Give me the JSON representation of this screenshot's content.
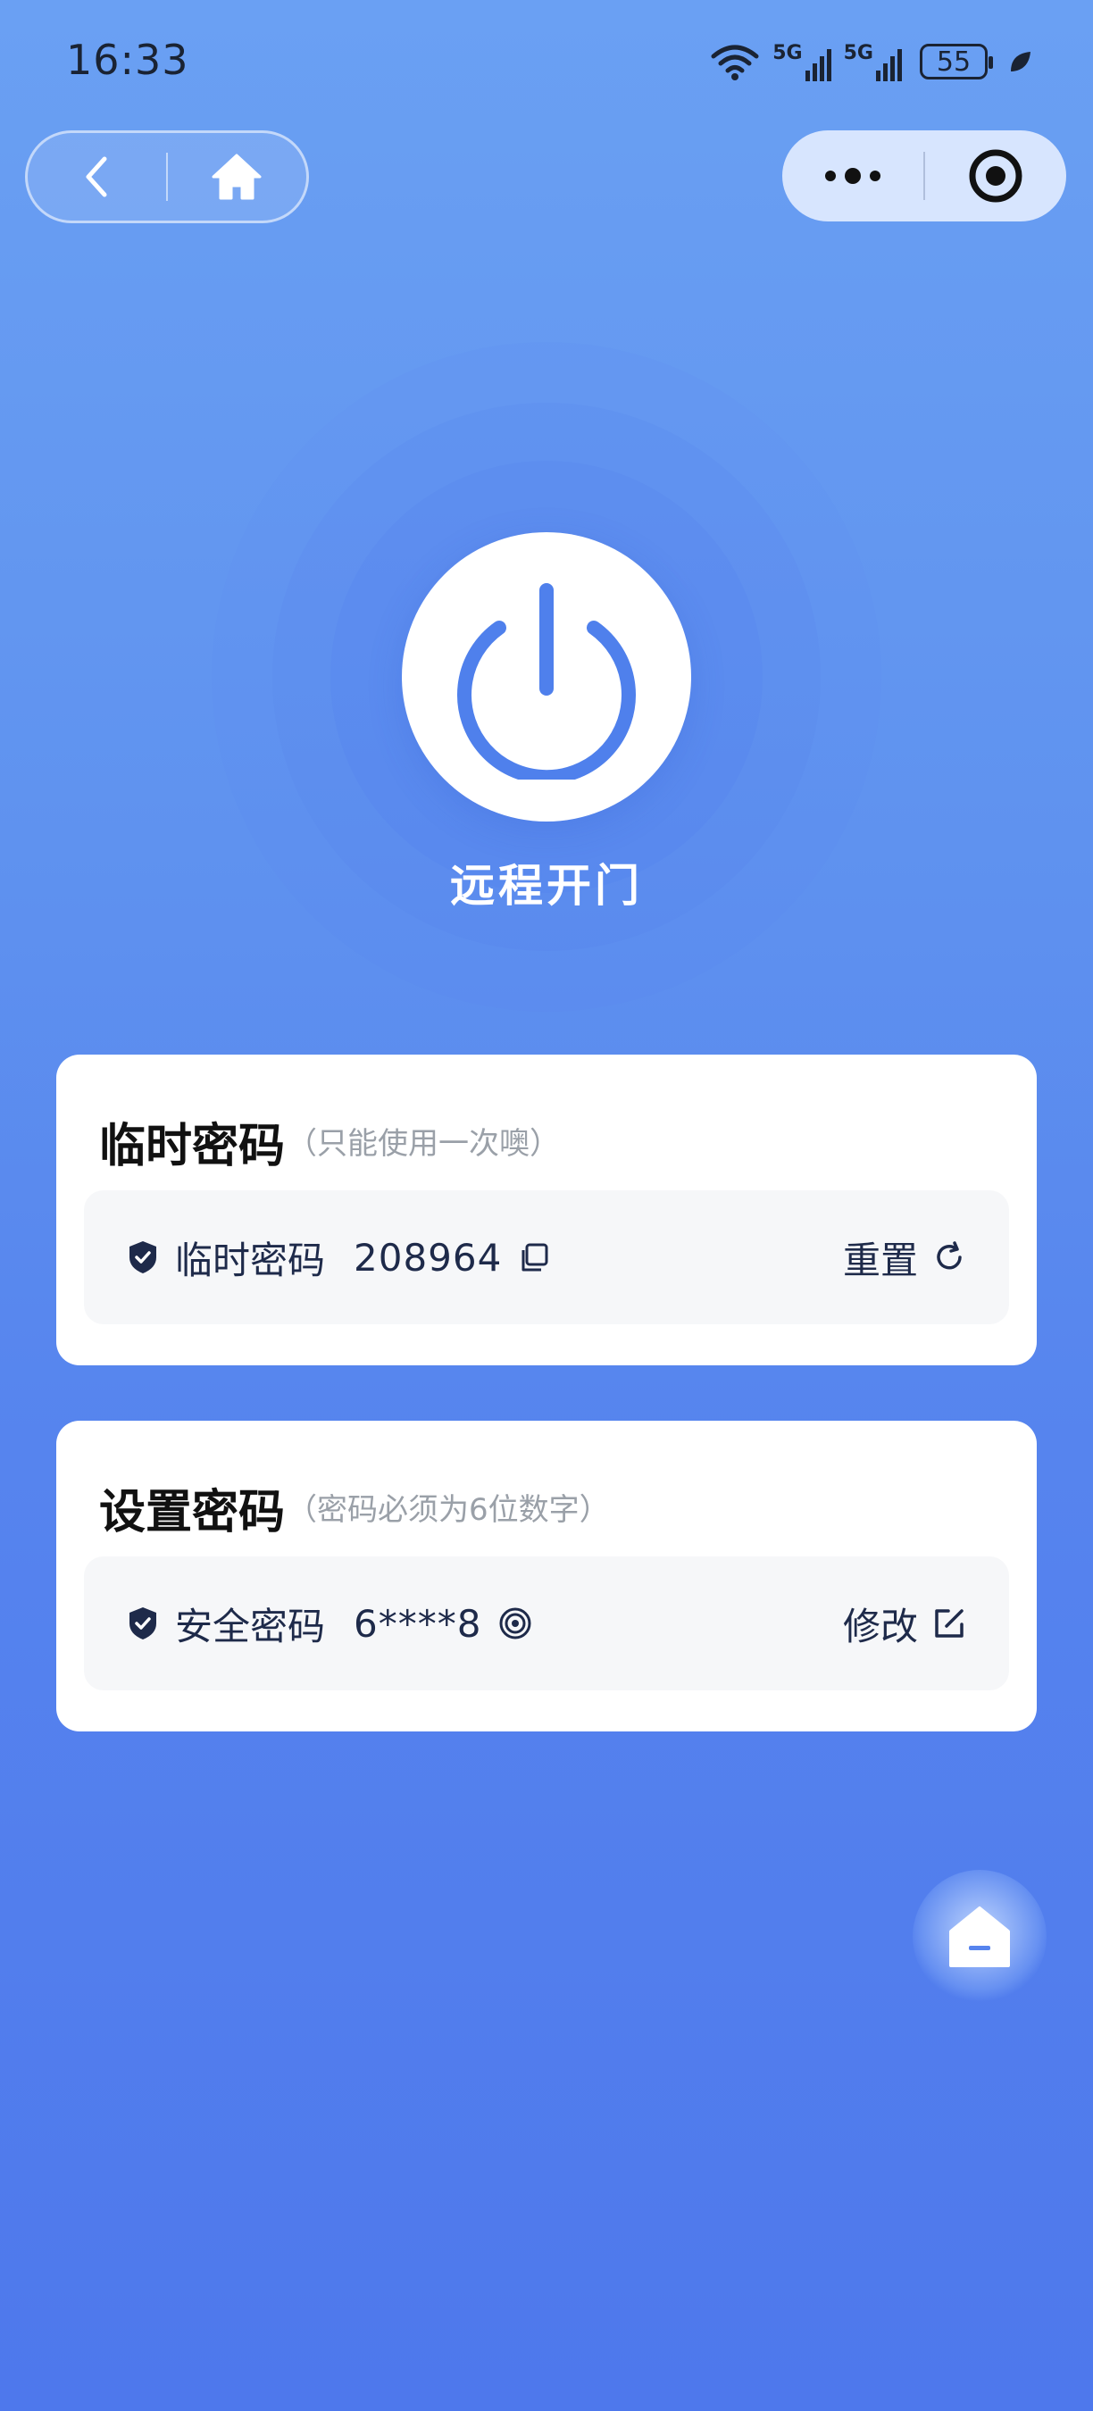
{
  "status_bar": {
    "time": "16:33",
    "network_1": "5G",
    "network_2": "5G",
    "battery": "55"
  },
  "remote_open": {
    "label": "远程开门"
  },
  "temp_password_card": {
    "title": "临时密码",
    "hint": "（只能使用一次噢）",
    "row_label": "临时密码",
    "password": "208964",
    "action": "重置"
  },
  "set_password_card": {
    "title": "设置密码",
    "hint": "（密码必须为6位数字）",
    "row_label": "安全密码",
    "password": "6****8",
    "action": "修改"
  },
  "icons": {
    "back": "chevron-left-icon",
    "home": "home-icon",
    "more": "more-icon",
    "close": "target-icon",
    "power": "power-icon",
    "shield": "shield-check-icon",
    "copy": "copy-icon",
    "refresh": "refresh-icon",
    "eye": "eye-icon",
    "edit": "edit-icon"
  },
  "colors": {
    "primary": "#4f80ec",
    "text_dark": "#1e2a4a"
  }
}
